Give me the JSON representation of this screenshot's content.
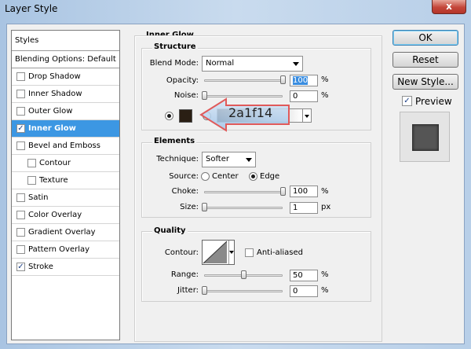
{
  "window": {
    "title": "Layer Style",
    "close_glyph": "x"
  },
  "styles_panel": {
    "header": "Styles",
    "blending": "Blending Options: Default",
    "items": [
      {
        "label": "Drop Shadow",
        "checked": false,
        "selected": false,
        "indent": false
      },
      {
        "label": "Inner Shadow",
        "checked": false,
        "selected": false,
        "indent": false
      },
      {
        "label": "Outer Glow",
        "checked": false,
        "selected": false,
        "indent": false
      },
      {
        "label": "Inner Glow",
        "checked": true,
        "selected": true,
        "indent": false
      },
      {
        "label": "Bevel and Emboss",
        "checked": false,
        "selected": false,
        "indent": false
      },
      {
        "label": "Contour",
        "checked": false,
        "selected": false,
        "indent": true
      },
      {
        "label": "Texture",
        "checked": false,
        "selected": false,
        "indent": true
      },
      {
        "label": "Satin",
        "checked": false,
        "selected": false,
        "indent": false
      },
      {
        "label": "Color Overlay",
        "checked": false,
        "selected": false,
        "indent": false
      },
      {
        "label": "Gradient Overlay",
        "checked": false,
        "selected": false,
        "indent": false
      },
      {
        "label": "Pattern Overlay",
        "checked": false,
        "selected": false,
        "indent": false
      },
      {
        "label": "Stroke",
        "checked": true,
        "selected": false,
        "indent": false
      }
    ]
  },
  "inner_glow": {
    "title": "Inner Glow",
    "structure": {
      "title": "Structure",
      "blend_mode_label": "Blend Mode:",
      "blend_mode": "Normal",
      "opacity_label": "Opacity:",
      "opacity": "100",
      "opacity_fraction": 1.0,
      "noise_label": "Noise:",
      "noise": "0",
      "noise_fraction": 0.0,
      "unit": "%",
      "glow_color": "#2a1f14",
      "color_annotation": "2a1f14"
    },
    "elements": {
      "title": "Elements",
      "technique_label": "Technique:",
      "technique": "Softer",
      "source_label": "Source:",
      "source_center": "Center",
      "source_edge": "Edge",
      "choke_label": "Choke:",
      "choke": "100",
      "choke_fraction": 1.0,
      "size_label": "Size:",
      "size": "1",
      "size_fraction": 0.0,
      "percent": "%",
      "px": "px"
    },
    "quality": {
      "title": "Quality",
      "contour_label": "Contour:",
      "anti_aliased": "Anti-aliased",
      "range_label": "Range:",
      "range": "50",
      "range_fraction": 0.5,
      "jitter_label": "Jitter:",
      "jitter": "0",
      "jitter_fraction": 0.0,
      "unit": "%"
    }
  },
  "buttons": {
    "ok": "OK",
    "reset": "Reset",
    "new_style": "New Style...",
    "preview": "Preview"
  },
  "colors": {
    "selection": "#3c97e3",
    "annotation_arrow": "#e86a6a",
    "title_gradient": "#c9dbee"
  }
}
